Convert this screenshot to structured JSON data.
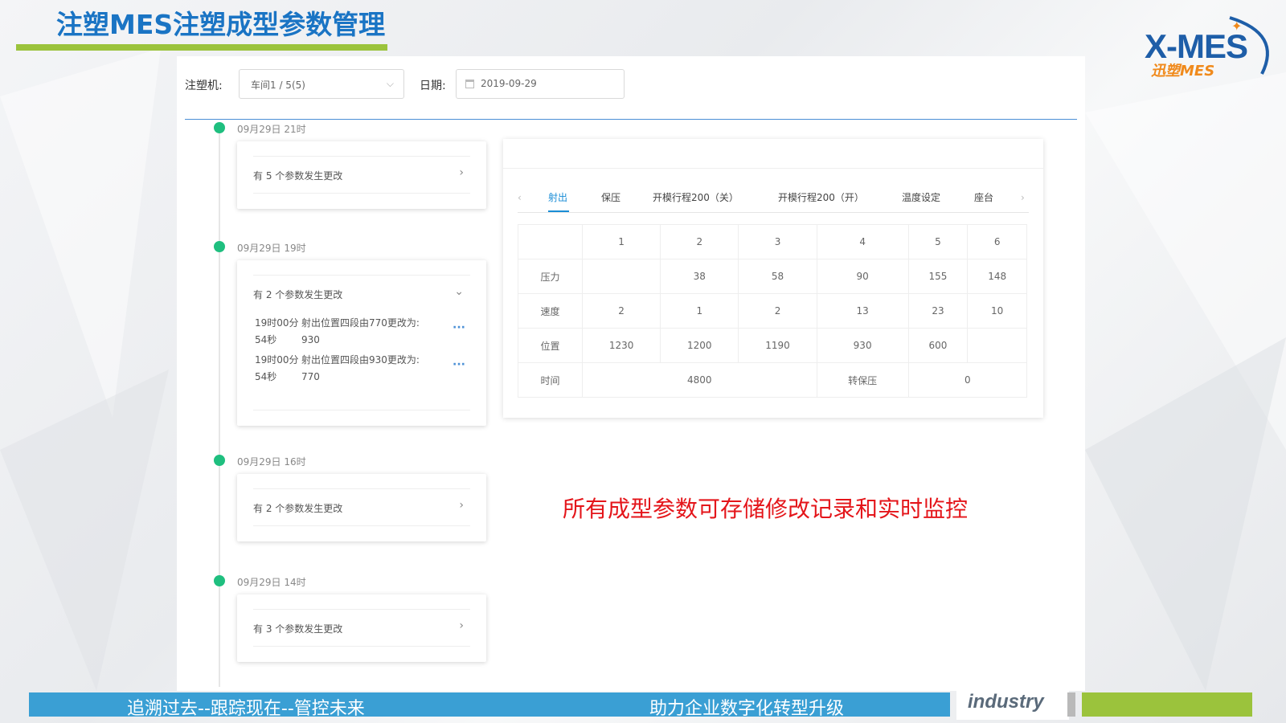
{
  "slide": {
    "title": "注塑MES注塑成型参数管理",
    "logo": "X-MES",
    "logo_sub": "迅塑MES",
    "caption": "所有成型参数可存储修改记录和实时监控",
    "footer_left": "追溯过去--跟踪现在--管控未来",
    "footer_right": "助力企业数字化转型升级",
    "footer_brand": "industry"
  },
  "filters": {
    "machine_label": "注塑机:",
    "machine_value": "车间1 / 5(5)",
    "date_label": "日期:",
    "date_value": "2019-09-29"
  },
  "timeline": [
    {
      "time": "09月29日 21时",
      "summary": "有 5 个参数发生更改"
    },
    {
      "time": "09月29日 19时",
      "summary": "有 2 个参数发生更改",
      "details": [
        {
          "t1": "19时00分",
          "t2": "54秒",
          "d1": "射出位置四段由770更改为:",
          "d2": "930"
        },
        {
          "t1": "19时00分",
          "t2": "54秒",
          "d1": "射出位置四段由930更改为:",
          "d2": "770"
        }
      ]
    },
    {
      "time": "09月29日 16时",
      "summary": "有 2 个参数发生更改"
    },
    {
      "time": "09月29日 14时",
      "summary": "有 3 个参数发生更改"
    }
  ],
  "tabs": [
    "射出",
    "保压",
    "开模行程200（关）",
    "开模行程200（开）",
    "温度设定",
    "座台"
  ],
  "table": {
    "columns": [
      "1",
      "2",
      "3",
      "4",
      "5",
      "6"
    ],
    "rows": [
      {
        "label": "压力",
        "values": [
          "",
          "38",
          "58",
          "90",
          "155",
          "148"
        ]
      },
      {
        "label": "速度",
        "values": [
          "2",
          "1",
          "2",
          "13",
          "23",
          "10"
        ]
      },
      {
        "label": "位置",
        "values": [
          "1230",
          "1200",
          "1190",
          "930",
          "600",
          ""
        ]
      }
    ],
    "time_label": "时间",
    "time_value": "4800",
    "hold_label": "转保压",
    "hold_value": "0"
  },
  "colors": {
    "brand_blue": "#1a74c4",
    "accent_green": "#9bc33c",
    "tab_active": "#1a8dd6",
    "timeline_dot": "#1fbf7f",
    "caption_red": "#e4151a"
  }
}
